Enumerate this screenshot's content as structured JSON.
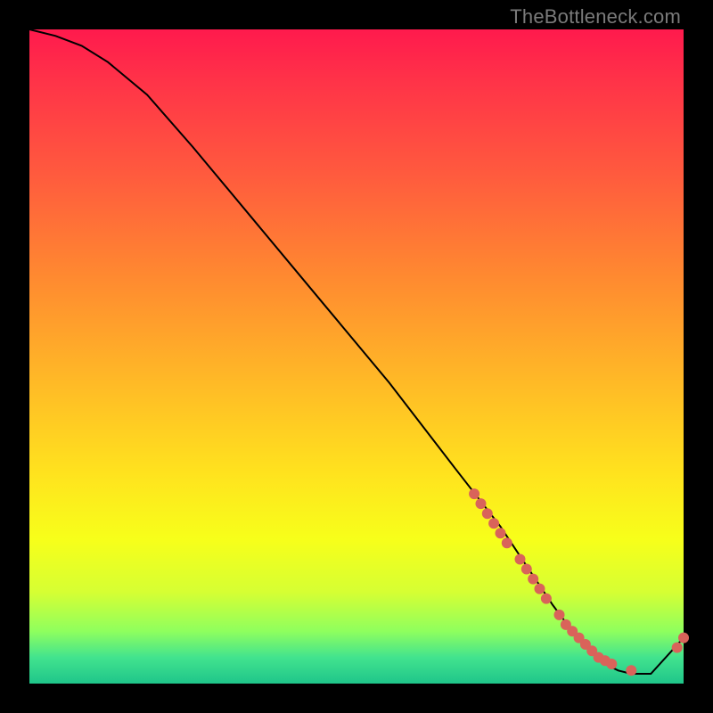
{
  "watermark": "TheBottleneck.com",
  "chart_data": {
    "type": "line",
    "title": "",
    "xlabel": "",
    "ylabel": "",
    "xlim": [
      0,
      100
    ],
    "ylim": [
      0,
      100
    ],
    "grid": false,
    "axes_visible": false,
    "background_gradient": [
      "#ff1a4d",
      "#ff8a30",
      "#ffe31e",
      "#1fc58a"
    ],
    "x": [
      0,
      4,
      8,
      12,
      18,
      25,
      35,
      45,
      55,
      65,
      72,
      76,
      80,
      83,
      86,
      88,
      90,
      92,
      95,
      100
    ],
    "y": [
      100,
      99,
      97.5,
      95,
      90,
      82,
      70,
      58,
      46,
      33,
      24,
      18,
      12,
      8,
      5,
      3,
      2,
      1.5,
      1.5,
      7
    ],
    "markers": {
      "x": [
        68,
        69,
        70,
        71,
        72,
        73,
        75,
        76,
        77,
        78,
        79,
        81,
        82,
        83,
        84,
        85,
        86,
        87,
        88,
        89,
        92,
        99,
        100
      ],
      "y": [
        29,
        27.5,
        26,
        24.5,
        23,
        21.5,
        19,
        17.5,
        16,
        14.5,
        13,
        10.5,
        9,
        8,
        7,
        6,
        5,
        4,
        3.5,
        3,
        2,
        5.5,
        7
      ]
    }
  }
}
